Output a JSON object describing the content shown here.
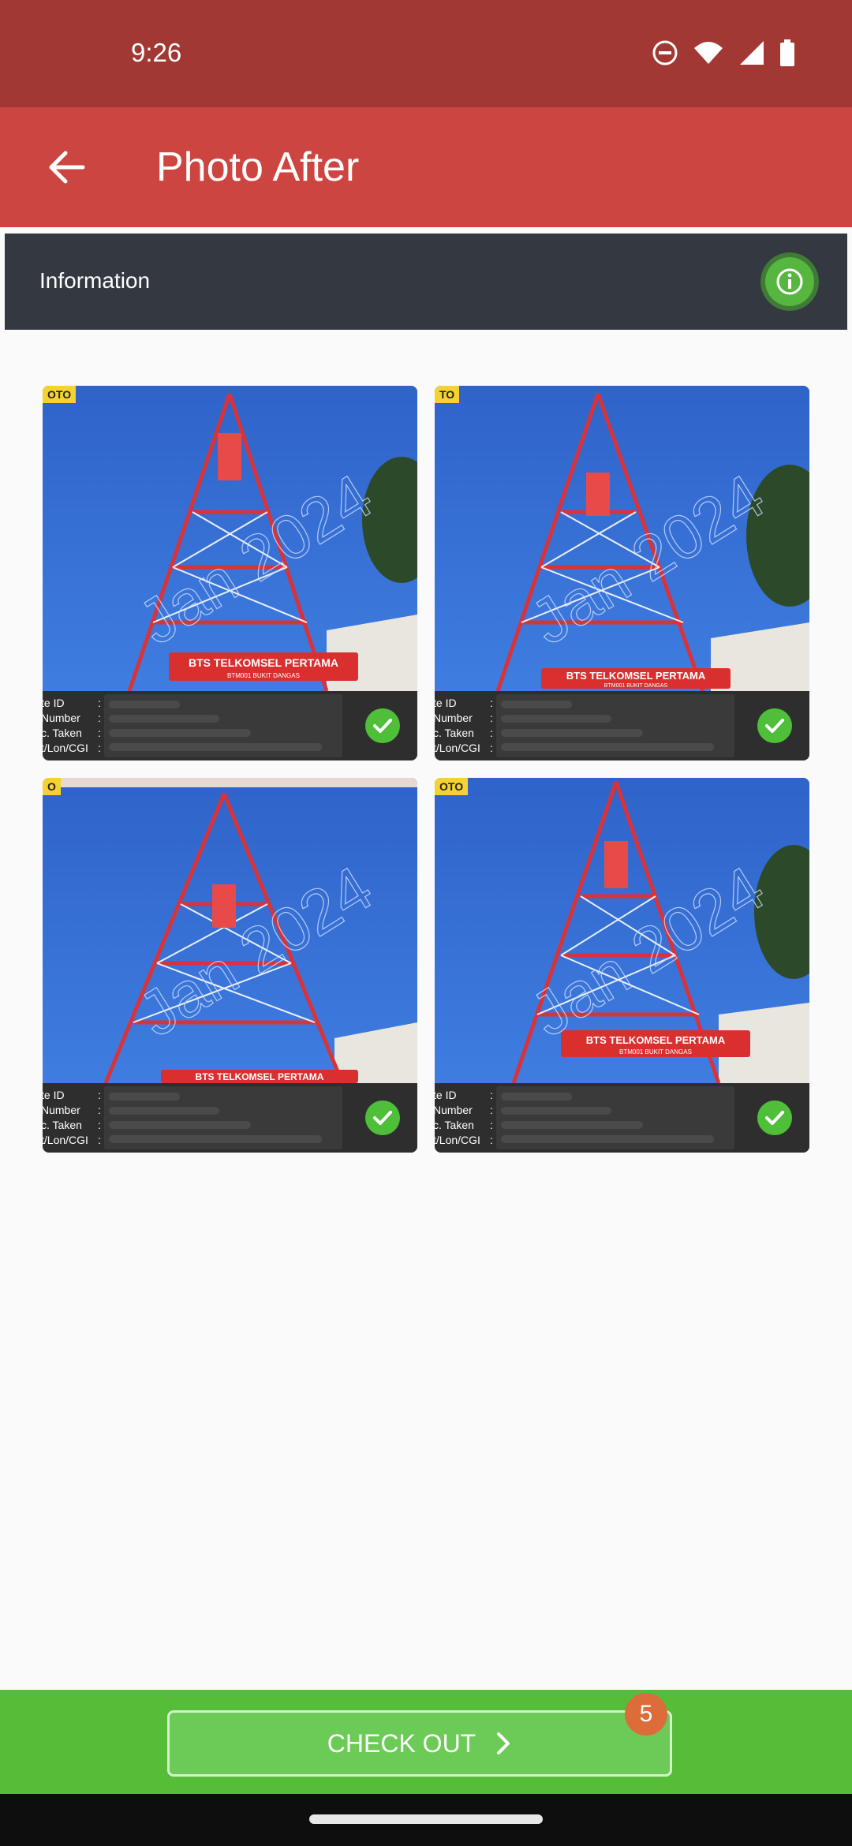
{
  "status_bar": {
    "time": "9:26",
    "icons": [
      "do-not-disturb-icon",
      "wifi-icon",
      "signal-icon",
      "battery-icon"
    ]
  },
  "app_bar": {
    "back_icon": "arrow-left-icon",
    "title": "Photo After"
  },
  "info_panel": {
    "label": "Information",
    "icon": "info-icon",
    "icon_color": "#56b640"
  },
  "photos": [
    {
      "tag": "OTO",
      "banner_title": "BTS TELKOMSEL PERTAMA",
      "banner_sub": "BTM001 BUKIT DANGAS",
      "watermark": "Jan 2024",
      "meta_labels": [
        "te ID",
        "Number",
        "c. Taken",
        "t/Lon/CGI"
      ],
      "status": "approved"
    },
    {
      "tag": "TO",
      "banner_title": "BTS TELKOMSEL PERTAMA",
      "banner_sub": "BTM001 BUKIT DANGAS",
      "watermark": "Jan 2024",
      "meta_labels": [
        "te ID",
        "Number",
        "c. Taken",
        "t/Lon/CGI"
      ],
      "status": "approved"
    },
    {
      "tag": "O",
      "banner_title": "BTS TELKOMSEL PERTAMA",
      "banner_sub": "",
      "watermark": "Jan 2024",
      "meta_labels": [
        "te ID",
        "Number",
        "c. Taken",
        "t/Lon/CGI"
      ],
      "status": "approved"
    },
    {
      "tag": "OTO",
      "banner_title": "BTS TELKOMSEL PERTAMA",
      "banner_sub": "BTM001 BUKIT DANGAS",
      "watermark": "Jan 2024",
      "meta_labels": [
        "te ID",
        "Number",
        "c. Taken",
        "t/Lon/CGI"
      ],
      "status": "approved"
    }
  ],
  "bottom": {
    "checkout_label": "CHECK OUT",
    "badge_count": "5",
    "accent": "#56bd38"
  }
}
